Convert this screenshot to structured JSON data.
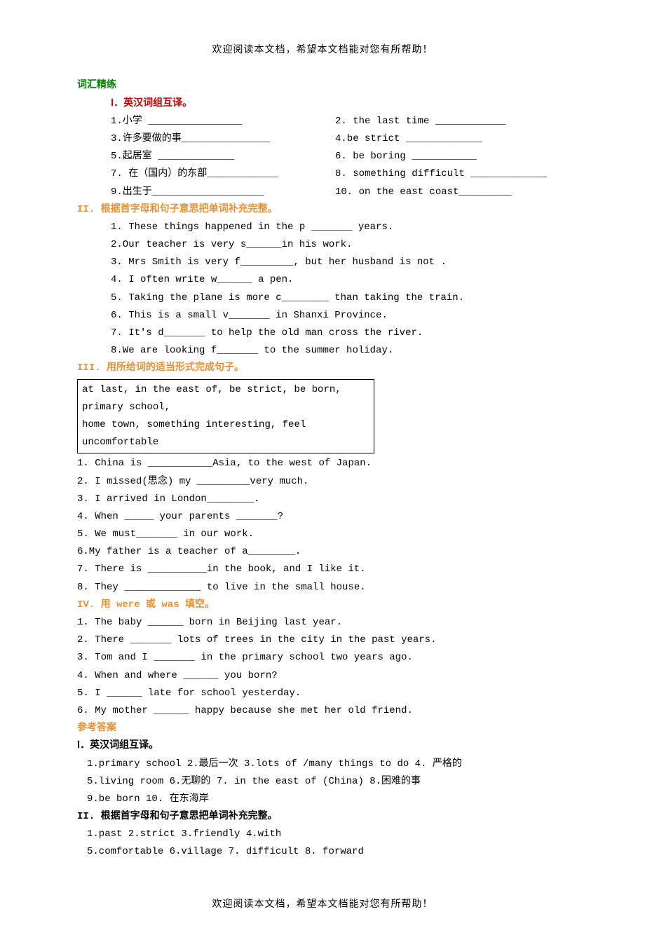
{
  "header": "欢迎阅读本文档，希望本文档能对您有所帮助！",
  "footer": "欢迎阅读本文档，希望本文档能对您有所帮助！",
  "mainTitle": "词汇精练",
  "section1": {
    "title": "Ⅰ．英汉词组互译。",
    "rows": [
      {
        "left": "1.小学 ________________",
        "right": "2. the last time ____________"
      },
      {
        "left": "3.许多要做的事_______________",
        "right": "4.be strict _____________"
      },
      {
        "left": "5.起居室  _____________",
        "right": "6. be boring ___________"
      },
      {
        "left": "7. 在（国内）的东部____________",
        "right": "  8. something difficult _____________"
      },
      {
        "left": "9.出生于___________________",
        "right": "10. on the east coast_________"
      }
    ]
  },
  "section2": {
    "title": "II. 根据首字母和句子意思把单词补充完整。",
    "items": [
      "1. These things happened in the p _______ years.",
      "2.Our teacher is very s______in his work.",
      "3. Mrs Smith is very f_________, but her husband is not .",
      "4. I often write w______ a pen.",
      "5. Taking the plane is more c________ than taking the train.",
      "6. This is a small v_______ in Shanxi Province.",
      "7. It's d_______ to help the old man cross the river.",
      "8.We are looking f_______ to the summer holiday."
    ]
  },
  "section3": {
    "title": "III. 用所给词的适当形式完成句子。",
    "box": [
      "at last, in the east of, be strict, be born, primary school,",
      "home town, something interesting, feel uncomfortable"
    ],
    "items": [
      "1. China is ___________Asia, to the west of Japan.",
      "2. I missed(思念) my _________very much.",
      "3. I arrived in London________.",
      "4. When _____ your parents _______?",
      "5. We must_______ in our work.",
      "6.My father is a teacher of a________.",
      "7. There is __________in the book, and I like it.",
      "8. They _____________ to live in the small house."
    ]
  },
  "section4": {
    "title": "IV. 用 were 或 was 填空。",
    "items": [
      "1. The baby ______ born in Beijing last year.",
      "2. There _______ lots of trees in the city in the past years.",
      "3. Tom and I _______ in the primary school two years ago.",
      "4. When and where ______ you born?",
      "5. I ______ late for school yesterday.",
      "6. My mother ______ happy because she met her old friend."
    ]
  },
  "answers": {
    "title": "参考答案",
    "s1title": "Ⅰ．英汉词组互译。",
    "s1": [
      "1.primary school   2.最后一次   3.lots of /many things to do   4. 严格的",
      "5.living room     6.无聊的    7. in the east of (China)  8.困难的事",
      "9.be born       10. 在东海岸"
    ],
    "s2title": "II. 根据首字母和句子意思把单词补充完整。",
    "s2": [
      "1.past       2.strict    3.friendly    4.with",
      "5.comfortable  6.village   7. difficult   8. forward"
    ]
  }
}
